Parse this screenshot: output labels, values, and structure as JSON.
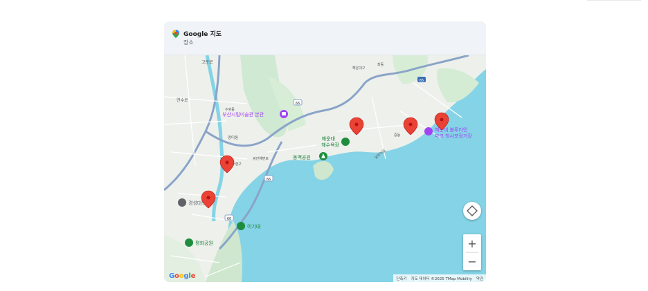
{
  "header": {
    "title": "Google 지도",
    "subtitle": "장소"
  },
  "map": {
    "labels": {
      "museum": "부산시립미술관 본관",
      "haeundae_beach_1": "해운대",
      "haeundae_beach_2": "해수욕장",
      "dongbaek": "동백공원",
      "blueline_1": "해운대 블루라인",
      "blueline_2": "파크 청사포정거장",
      "kyungsung": "경성대학교",
      "igidae": "이기대",
      "pyeonghwa": "평화공원",
      "gobun": "고분로",
      "yeonsu": "연수로",
      "suyeong": "수영동",
      "mangmi": "망미동",
      "haeundae_gu": "해운대구",
      "jung": "중동",
      "jwa": "좌동",
      "suyeong_gu": "수영구",
      "gwangan": "광안해변로",
      "dalmaji": "달맞이길",
      "highway_66": "66",
      "highway_65": "65",
      "highway_66b": "66",
      "highway_66c": "66"
    },
    "markers_count": 5
  },
  "controls": {
    "zoom_in": "+",
    "zoom_out": "−"
  },
  "attribution": {
    "shortcuts": "단축키",
    "data": "지도 데이터 ©2025 TMap Mobility",
    "terms": "약관"
  },
  "logo": {
    "g1": "G",
    "g2": "o",
    "g3": "o",
    "g4": "g",
    "g5": "l",
    "g6": "e"
  }
}
